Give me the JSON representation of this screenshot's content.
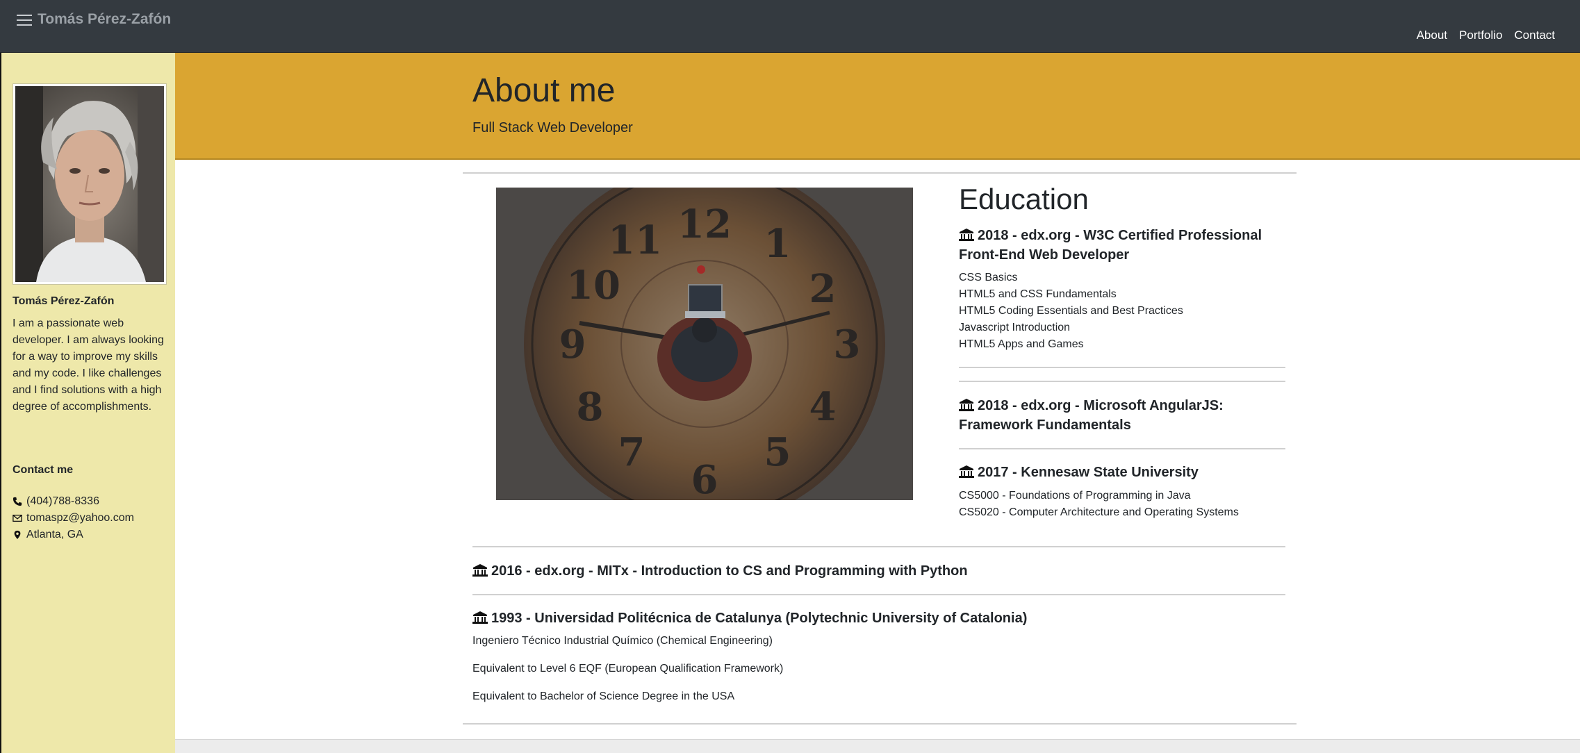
{
  "navbar": {
    "brand": "Tomás Pérez-Zafón",
    "links": [
      "About",
      "Portfolio",
      "Contact"
    ]
  },
  "sidebar": {
    "name": "Tomás Pérez-Zafón",
    "bio": "I am a passionate web developer. I am always looking for a way to improve my skills and my code. I like challenges and I find solutions with a high degree of accomplishments.",
    "contact_title": "Contact me",
    "phone": "(404)788-8336",
    "email": "tomaspz@yahoo.com",
    "location": "Atlanta, GA"
  },
  "header": {
    "title": "About me",
    "subtitle": "Full Stack Web Developer"
  },
  "education": {
    "title": "Education",
    "entries": [
      {
        "heading": "2018 - edx.org - W3C Certified Professional Front-End Web Developer",
        "items": [
          "CSS Basics",
          "HTML5 and CSS Fundamentals",
          "HTML5 Coding Essentials and Best Practices",
          "Javascript Introduction",
          "HTML5 Apps and Games"
        ]
      },
      {
        "heading": "2018 - edx.org - Microsoft AngularJS: Framework Fundamentals",
        "items": []
      },
      {
        "heading": "2017 - Kennesaw State University",
        "items": [
          "CS5000 - Foundations of Programming in Java",
          "CS5020 - Computer Architecture and Operating Systems"
        ]
      },
      {
        "heading": "2016 - edx.org - MITx - Introduction to CS and Programming with Python",
        "items": []
      },
      {
        "heading": "1993 - Universidad Politécnica de Catalunya (Polytechnic University of Catalonia)",
        "items": [
          "Ingeniero Técnico Industrial Químico (Chemical Engineering)",
          "Equivalent to Level 6 EQF (European Qualification Framework)",
          "Equivalent to Bachelor of Science Degree in the USA"
        ]
      }
    ]
  },
  "icons": {
    "menu": "hamburger-icon",
    "phone": "phone-icon",
    "email": "envelope-icon",
    "location": "map-marker-icon",
    "institution": "university-icon"
  },
  "colors": {
    "navbar": "#343a40",
    "sidebar": "#eee8aa",
    "header_band": "#daa531"
  }
}
